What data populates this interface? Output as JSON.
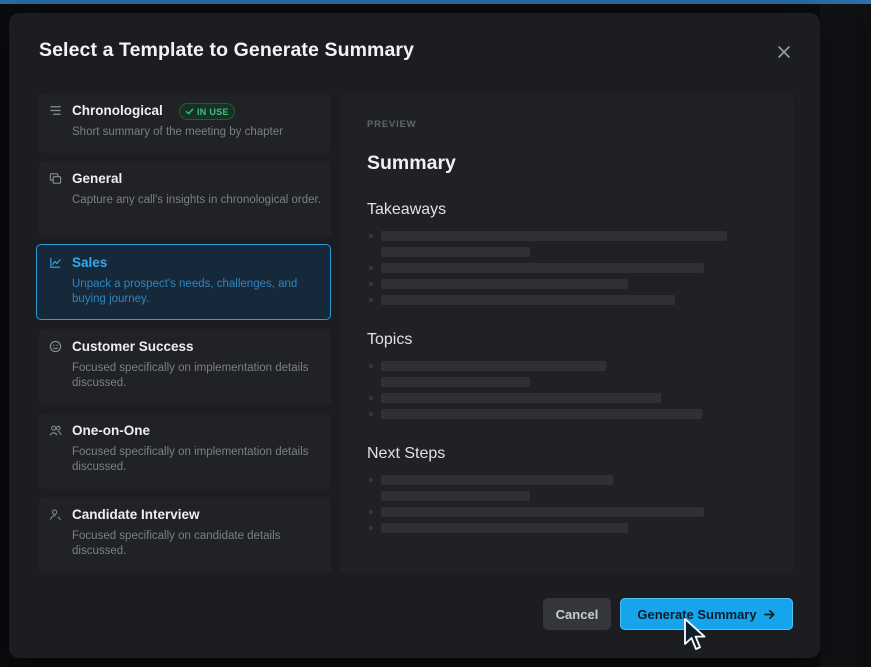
{
  "dialog": {
    "title": "Select a Template to Generate Summary",
    "close_icon": "close-icon"
  },
  "templates": [
    {
      "icon": "list-lines-icon",
      "title": "Chronological",
      "badge": "IN USE",
      "description": "Short summary of the meeting by chapter"
    },
    {
      "icon": "cards-icon",
      "title": "General",
      "description": "Capture any call's insights in chronological order."
    },
    {
      "icon": "line-chart-icon",
      "title": "Sales",
      "description": "Unpack a prospect's needs, challenges, and buying journey.",
      "selected": true
    },
    {
      "icon": "smiley-icon",
      "title": "Customer Success",
      "description": "Focused specifically on implementation details discussed."
    },
    {
      "icon": "two-people-icon",
      "title": "One-on-One",
      "description": "Focused specifically on implementation details discussed."
    },
    {
      "icon": "person-search-icon",
      "title": "Candidate Interview",
      "description": "Focused specifically on candidate details discussed."
    }
  ],
  "preview": {
    "label": "PREVIEW",
    "title": "Summary",
    "sections": [
      "Takeaways",
      "Topics",
      "Next Steps"
    ]
  },
  "actions": {
    "cancel": "Cancel",
    "generate": "Generate Summary"
  },
  "colors": {
    "accent": "#16a4ec",
    "selected_border": "#2e9ad8",
    "badge_green": "#3fc07a"
  }
}
